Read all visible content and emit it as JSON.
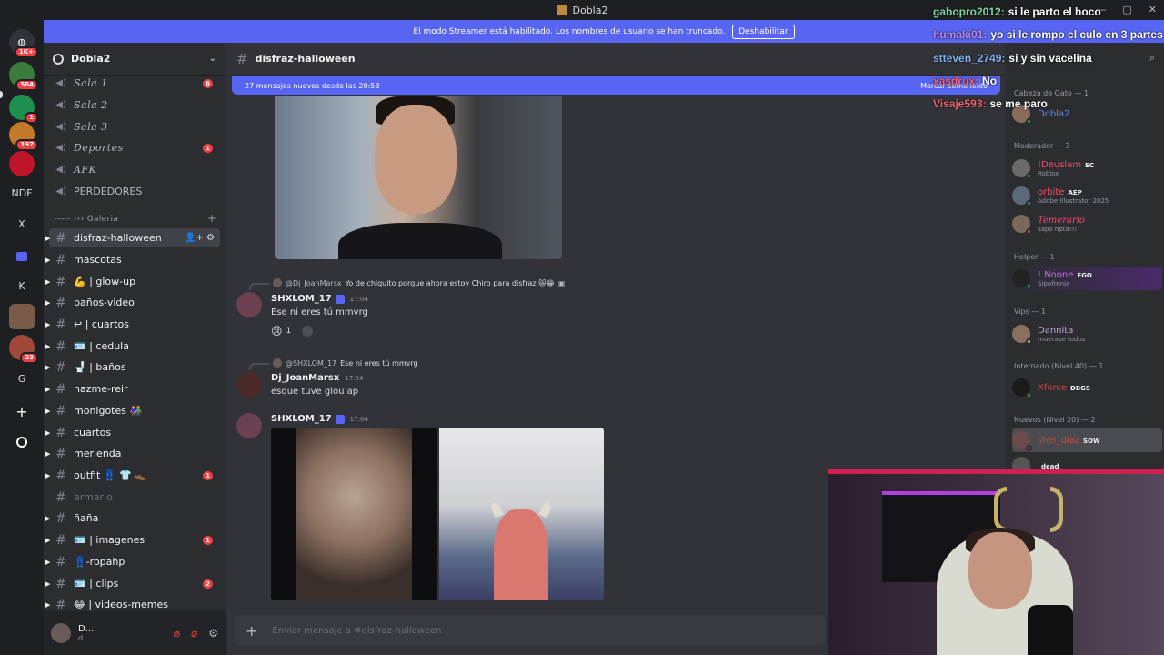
{
  "window": {
    "title": "Dobla2",
    "controls": [
      "—",
      "▢",
      "✕"
    ]
  },
  "servers": [
    {
      "label": "",
      "badge": "1K+"
    },
    {
      "label": "",
      "badge": "564"
    },
    {
      "label": "",
      "badge": "1"
    },
    {
      "label": "",
      "badge": "197"
    },
    {
      "label": "",
      "badge": ""
    },
    {
      "label": "NDF",
      "badge": ""
    },
    {
      "label": "X",
      "badge": ""
    },
    {
      "label": "",
      "badge": ""
    },
    {
      "label": "K",
      "badge": ""
    },
    {
      "label": "",
      "badge": ""
    },
    {
      "label": "",
      "badge": "23"
    },
    {
      "label": "G",
      "badge": ""
    },
    {
      "label": "+",
      "badge": ""
    },
    {
      "label": "",
      "badge": ""
    }
  ],
  "banner": {
    "text": "El modo Streamer está habilitado. Los nombres de usuario se han truncado.",
    "button": "Deshabilitar"
  },
  "guild": {
    "name": "Dobla2"
  },
  "voice_channels": [
    {
      "label": "Sala 1",
      "count": "6"
    },
    {
      "label": "Sala 2",
      "count": ""
    },
    {
      "label": "Sala 3",
      "count": ""
    },
    {
      "label": "Deportes",
      "count": "1"
    },
    {
      "label": "AFK",
      "count": ""
    },
    {
      "label": "PERDEDORES",
      "count": ""
    }
  ],
  "category": {
    "label": "----- ››› Galeria",
    "plus": "+"
  },
  "text_channels": [
    {
      "label": "disfraz-halloween",
      "count": ""
    },
    {
      "label": "mascotas",
      "count": ""
    },
    {
      "label": "💪 | glow-up",
      "count": ""
    },
    {
      "label": "baños-video",
      "count": ""
    },
    {
      "label": "↩ | cuartos",
      "count": ""
    },
    {
      "label": "🪪 | cedula",
      "count": ""
    },
    {
      "label": "🚽 | baños",
      "count": ""
    },
    {
      "label": "hazme-reir",
      "count": ""
    },
    {
      "label": "monigotes 👫",
      "count": ""
    },
    {
      "label": "cuartos",
      "count": ""
    },
    {
      "label": "merienda",
      "count": ""
    },
    {
      "label": "outfit 👖 👕 👞",
      "count": "1"
    },
    {
      "label": "armario",
      "count": ""
    },
    {
      "label": "ñaña",
      "count": ""
    },
    {
      "label": "🪪 | imagenes",
      "count": "1"
    },
    {
      "label": "👖-ropahp",
      "count": ""
    },
    {
      "label": "🪪 | clips",
      "count": "2"
    },
    {
      "label": "😂 | videos-memes",
      "count": ""
    }
  ],
  "user_panel": {
    "name": "D...",
    "status": "d..."
  },
  "chat": {
    "channel": "disfraz-halloween",
    "new_messages": "27 mensajes nuevos desde las 20:53",
    "mark_read": "Marcar como leído",
    "messages": [
      {
        "reply_author": "@Dj_JoanMarsx",
        "reply_text": "Yo de chiquito porque ahora estoy Chiro para disfraz 😿😂",
        "author": "SHXLOM_17",
        "time": "17:04",
        "text": "Ese ni eres tú mmvrg",
        "reaction_emoji": "😢",
        "reaction_count": "1"
      },
      {
        "reply_author": "@SHXLOM_17",
        "reply_text": "Ese ni eres tú mmvrg",
        "author": "Dj_JoanMarsx",
        "time": "17:04",
        "text": "esque tuve glou ap"
      },
      {
        "author": "SHXLOM_17",
        "time": "17:04"
      }
    ],
    "composer_placeholder": "Enviar mensaje a #disfraz-halloween"
  },
  "members": {
    "groups": [
      {
        "label": "Cabeza de Gato — 1",
        "members": [
          {
            "name": "Dobla2",
            "color": "#5c8df6",
            "sub": "",
            "tag": ""
          }
        ]
      },
      {
        "label": "Moderador — 3",
        "members": [
          {
            "name": "!Deuslam",
            "color": "#f04d6a",
            "sub": "Roblox",
            "tag": "EC"
          },
          {
            "name": "orbite",
            "color": "#f04d6a",
            "sub": "Adobe Illustrator 2025",
            "tag": "AEP"
          },
          {
            "name": "Temerario",
            "color": "#f04d6a",
            "sub": "sapo hpta!!!",
            "tag": ""
          }
        ]
      },
      {
        "label": "Helper — 1",
        "members": [
          {
            "name": "! Noone",
            "color": "#c070e0",
            "sub": "Sipofrenia",
            "tag": "EGO"
          }
        ]
      },
      {
        "label": "Vips — 1",
        "members": [
          {
            "name": "Dannita",
            "color": "#c9a2d8",
            "sub": "muerase todos",
            "tag": ""
          }
        ]
      },
      {
        "label": "Internado (Nivel 40) — 1",
        "members": [
          {
            "name": "Xforce",
            "color": "#e04030",
            "sub": "",
            "tag": "DBGS"
          }
        ]
      },
      {
        "label": "Nuevos (Nivel 20) — 2",
        "members": [
          {
            "name": "shei_diaz",
            "color": "#e04030",
            "sub": "",
            "tag": "SOW"
          },
          {
            "name": "",
            "color": "#dbdee1",
            "sub": "",
            "tag": "dead"
          }
        ]
      }
    ]
  },
  "overlay_chat": [
    {
      "user": "gabopro2012:",
      "text": "si le parto el hoco",
      "color": "#7fd6a0"
    },
    {
      "user": "humaki01:",
      "text": "yo si le rompo el culo en 3 partes",
      "color": "#b78ce8"
    },
    {
      "user": "stteven_2749:",
      "text": "si y sin vacelina",
      "color": "#7fb0f0"
    },
    {
      "user": "xasdrux:",
      "text": "No",
      "color": "#f06070"
    },
    {
      "user": "Visaje593:",
      "text": "se me paro",
      "color": "#f06070"
    }
  ]
}
